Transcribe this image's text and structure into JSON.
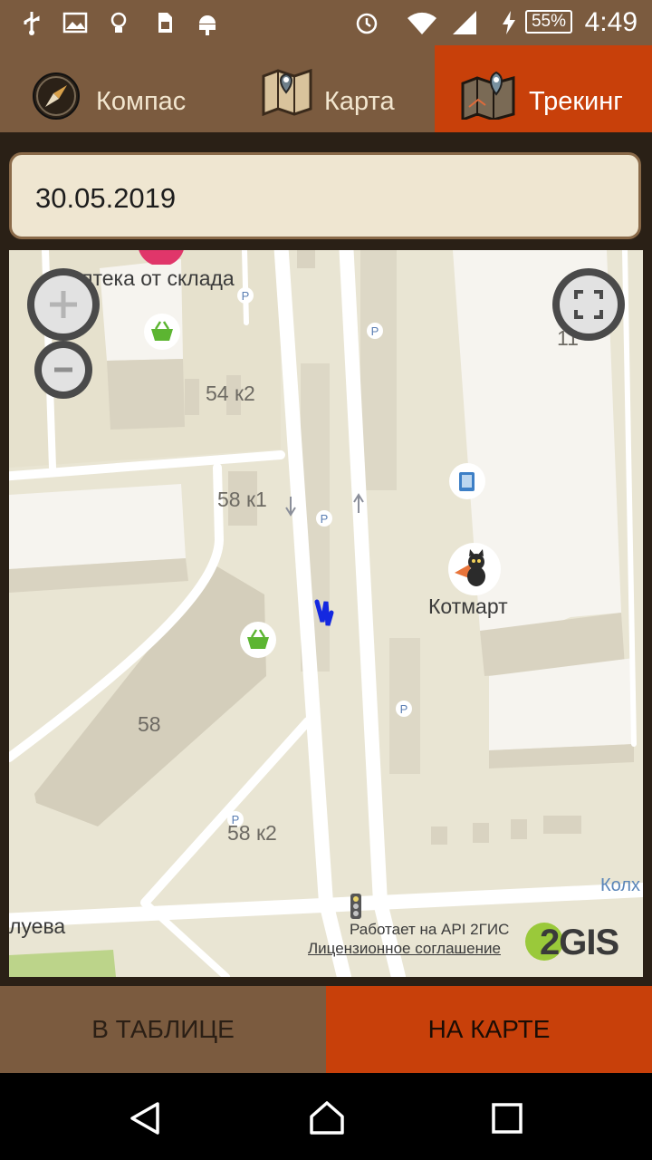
{
  "status_bar": {
    "time": "4:49",
    "battery": "55%"
  },
  "tabs": [
    {
      "label": "Компас",
      "icon": "compass-icon"
    },
    {
      "label": "Карта",
      "icon": "map-pin-icon"
    },
    {
      "label": "Трекинг",
      "icon": "tracking-map-icon",
      "active": true
    }
  ],
  "date": "30.05.2019",
  "map": {
    "labels": {
      "pharmacy": "птека от склада",
      "b54k2": "54 к2",
      "b58k1": "58 к1",
      "b58": "58",
      "b58k2": "58 к2",
      "b11": "11",
      "kotmart": "Котмарт",
      "kolh": "Колх",
      "lueva": "луева"
    },
    "attribution": {
      "api": "Работает на API 2ГИС",
      "license": "Лицензионное соглашение",
      "logo": "2GIS"
    }
  },
  "buttons": {
    "table": "В ТАБЛИЦЕ",
    "map": "НА КАРТЕ"
  },
  "colors": {
    "brown": "#7b5b3f",
    "accent": "#c8400a",
    "track": "#1428e0"
  }
}
